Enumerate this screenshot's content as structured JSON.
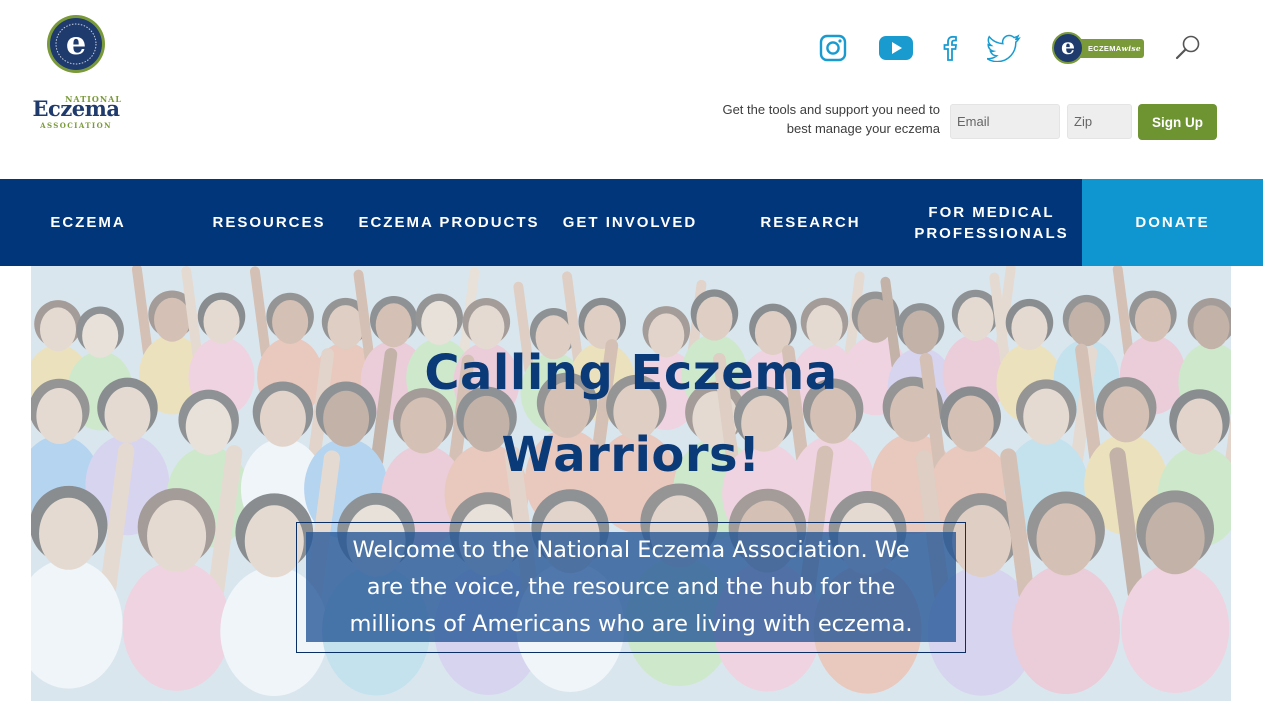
{
  "brand": {
    "logo_national": "NATIONAL",
    "logo_eczema": "Eczema",
    "logo_association": "ASSOCIATION",
    "seal_letter": "e",
    "navy": "#1f3a6d",
    "green": "#7a9a3a"
  },
  "header": {
    "social_icons": [
      "instagram-icon",
      "youtube-icon",
      "facebook-icon",
      "twitter-icon"
    ],
    "social_color": "#1a9bd0",
    "eczemawise": {
      "letter": "e",
      "label_plain": "ECZEMA",
      "label_italic": "wise"
    },
    "search_icon": "search-icon"
  },
  "signup": {
    "tagline_line1": "Get the tools and support you need to",
    "tagline_line2": "best manage your eczema",
    "email_placeholder": "Email",
    "zip_placeholder": "Zip",
    "button_label": "Sign Up",
    "button_color": "#6e9431"
  },
  "nav": {
    "background": "#02367a",
    "items": [
      {
        "label": "ECZEMA"
      },
      {
        "label": "RESOURCES"
      },
      {
        "label": "ECZEMA PRODUCTS"
      },
      {
        "label": "GET INVOLVED"
      },
      {
        "label": "RESEARCH"
      },
      {
        "label_line1": "FOR MEDICAL",
        "label_line2": "PROFESSIONALS"
      }
    ],
    "donate": {
      "label": "DONATE",
      "color": "#0f95cf"
    }
  },
  "hero": {
    "title_line1": "Calling Eczema",
    "title_line2": "Warriors!",
    "intro_line1": "Welcome to the National Eczema Association. We",
    "intro_line2": "are the voice, the resource and the hub for the",
    "intro_line3": "millions of Americans who are living with eczema.",
    "title_color": "#0a3a78"
  }
}
